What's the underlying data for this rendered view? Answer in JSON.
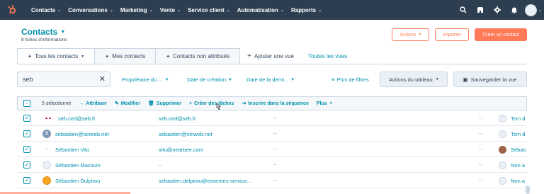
{
  "colors": {
    "nav_bg": "#2d3e50",
    "accent": "#ff7a59",
    "link": "#0091ae",
    "text": "#33475b"
  },
  "topnav": {
    "logo_icon": "hubspot-sprocket-icon",
    "items": [
      {
        "label": "Contacts"
      },
      {
        "label": "Conversations"
      },
      {
        "label": "Marketing"
      },
      {
        "label": "Vente"
      },
      {
        "label": "Service client"
      },
      {
        "label": "Automatisation"
      },
      {
        "label": "Rapports"
      }
    ],
    "right_icons": [
      "search-icon",
      "marketplace-icon",
      "settings-icon",
      "notifications-icon"
    ]
  },
  "header": {
    "title": "Contacts",
    "subtitle": "8 fiches d'informations",
    "actions_label": "Actions",
    "import_label": "Importer",
    "create_label": "Créer un contact"
  },
  "tabs": {
    "items": [
      {
        "label": "Tous les contacts"
      },
      {
        "label": "Mes contacts"
      },
      {
        "label": "Contacts non attribués"
      }
    ],
    "add_view_label": "Ajouter une vue",
    "all_views_label": "Toutes les vues"
  },
  "filters": {
    "search_value": "seb",
    "owner_label": "Propriétaire du ...",
    "created_label": "Date de création",
    "last_label": "Date de la derni...",
    "more_filters_label": "Plus de filtres",
    "table_actions_label": "Actions du tableau",
    "save_view_label": "Sauvegarder la vue"
  },
  "bulk": {
    "selected_label": "5 sélectionné",
    "assign_label": "Attribuer",
    "edit_label": "Modifier",
    "delete_label": "Supprimer",
    "tasks_label": "Créer des tâches",
    "sequence_label": "Inscrire dans la séquence",
    "more_label": "Plus"
  },
  "rows": [
    {
      "name": "seb.ced@seb.fr",
      "email": "seb.ced@seb.fr",
      "col3": "--",
      "col4": "--",
      "owner": "Tom d",
      "icon": "brand-logo-icon"
    },
    {
      "name": "sebastien@sinweb.net",
      "email": "sebastien@sinweb.net",
      "col3": "--",
      "col4": "--",
      "owner": "Tom d",
      "icon": "company-s-icon"
    },
    {
      "name": "Sébastien Vitu",
      "email": "vitu@nearbee.com",
      "col3": "--",
      "col4": "--",
      "owner": "Sébas",
      "icon": "placeholder-dash"
    },
    {
      "name": "Sébastien Macouin",
      "email": "--",
      "col3": "--",
      "col4": "--",
      "owner": "Non a",
      "icon": "default-avatar-icon"
    },
    {
      "name": "Sébastien Dulpirou",
      "email": "sebastien.delpirou@essemes-service...",
      "col3": "--",
      "col4": "--",
      "owner": "Non a",
      "icon": "company-logo-icon"
    }
  ]
}
